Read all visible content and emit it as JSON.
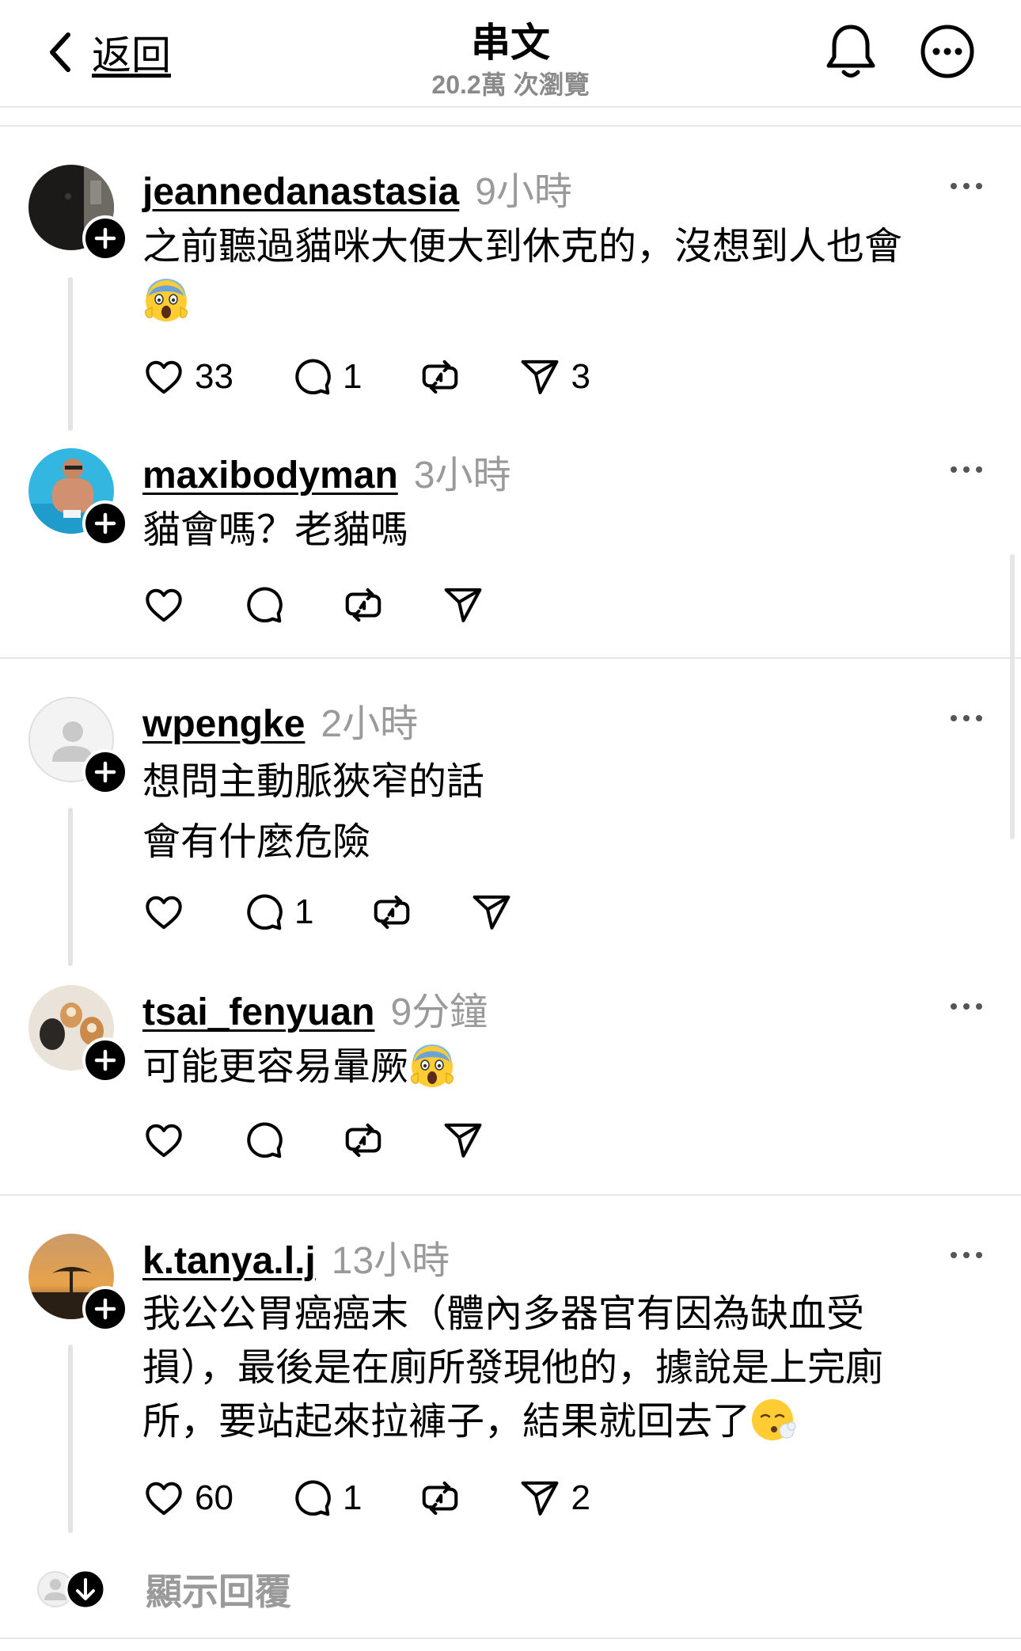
{
  "header": {
    "back_label": "返回",
    "title": "串文",
    "subtitle": "20.2萬 次瀏覽"
  },
  "comments": [
    {
      "username": "jeannedanastasia",
      "time": "9小時",
      "text_lines": [
        "之前聽過貓咪大便大到休克的，沒想到人也會"
      ],
      "emoji": "face-screaming-in-fear",
      "likes": "33",
      "replies": "1",
      "reposts": "",
      "shares": "3"
    },
    {
      "username": "maxibodyman",
      "time": "3小時",
      "text_lines": [
        "貓會嗎？老貓嗎"
      ],
      "likes": "",
      "replies": "",
      "reposts": "",
      "shares": ""
    },
    {
      "username": "wpengke",
      "time": "2小時",
      "text_lines": [
        "想問主動脈狹窄的話",
        "會有什麼危險"
      ],
      "likes": "",
      "replies": "1",
      "reposts": "",
      "shares": ""
    },
    {
      "username": "tsai_fenyuan",
      "time": "9分鐘",
      "text_lines": [
        "可能更容易暈厥"
      ],
      "emoji": "face-screaming-in-fear",
      "likes": "",
      "replies": "",
      "reposts": "",
      "shares": ""
    },
    {
      "username": "k.tanya.l.j",
      "time": "13小時",
      "text_lines": [
        "我公公胃癌癌末（體內多器官有因為缺血受",
        "損），最後是在廁所發現他的，據說是上完廁",
        "所，要站起來拉褲子，結果就回去了"
      ],
      "emoji": "face-exhaling",
      "likes": "60",
      "replies": "1",
      "reposts": "",
      "shares": "2"
    }
  ],
  "show_replies_label": "顯示回覆",
  "icons": [
    "chevron-left-icon",
    "bell-icon",
    "more-circle-icon",
    "heart-icon",
    "comment-icon",
    "repost-icon",
    "send-icon",
    "plus-icon",
    "more-dots-icon",
    "arrow-down-icon"
  ],
  "colors": {
    "text": "#000000",
    "muted": "#9a9a9a",
    "divider": "#e6e6e6"
  }
}
